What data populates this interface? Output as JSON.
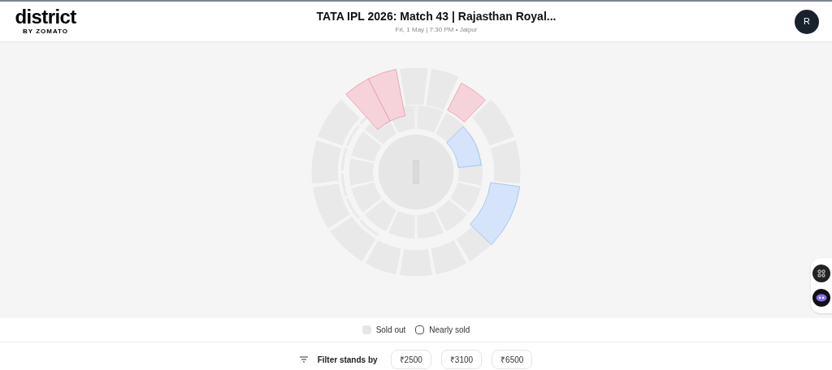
{
  "header": {
    "logo": "district",
    "logo_sub": "BY ZOMATO",
    "title": "TATA IPL 2026: Match 43 | Rajasthan Royal...",
    "subtitle": "Fri, 1 May | 7:30 PM • Jaipur",
    "avatar": "R"
  },
  "stands": [
    {
      "kind": "limited"
    },
    {
      "kind": "limited"
    },
    {
      "kind": "limited"
    },
    {
      "kind": "offered"
    },
    {
      "kind": "offered"
    }
  ],
  "legend": [
    {
      "label": "Sold out",
      "kind": "soldout"
    },
    {
      "label": "Nearly sold",
      "kind": "nearly"
    }
  ],
  "filter": {
    "label": "Filter stands by",
    "prices": [
      {
        "label": "₹2500",
        "selected": false
      },
      {
        "label": "₹3100",
        "selected": false
      },
      {
        "label": "₹6500",
        "selected": false
      }
    ]
  }
}
